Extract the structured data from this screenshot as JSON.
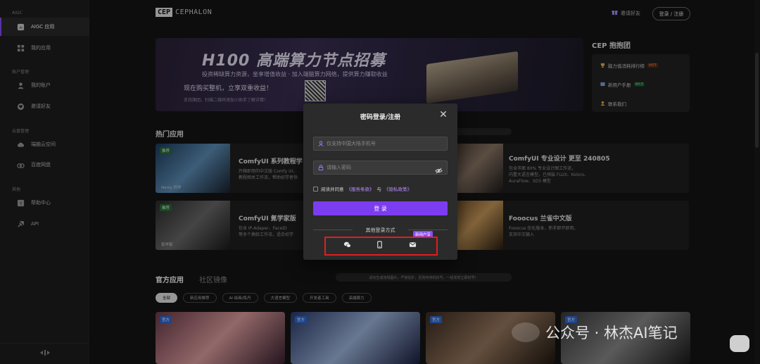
{
  "sidebar": {
    "sections": [
      {
        "label": "AIGC"
      },
      {
        "label": "账户管理"
      },
      {
        "label": "云盘管理"
      },
      {
        "label": "其他"
      }
    ],
    "items": [
      {
        "label": "AIGC 应用",
        "icon": "ai-icon"
      },
      {
        "label": "我的应用",
        "icon": "grid-icon"
      },
      {
        "label": "我的账户",
        "icon": "user-icon"
      },
      {
        "label": "邀请好友",
        "icon": "heart-icon"
      },
      {
        "label": "端脑云空间",
        "icon": "cloud-icon"
      },
      {
        "label": "百度网盘",
        "icon": "baidu-icon"
      },
      {
        "label": "帮助中心",
        "icon": "help-icon"
      },
      {
        "label": "API",
        "icon": "api-icon"
      }
    ]
  },
  "header": {
    "logo_box": "CEP",
    "logo_text": "CEPHALON",
    "invite_label": "邀请好友",
    "login_label": "登录 / 注册"
  },
  "banner": {
    "title": "H100 高端算力节点招募",
    "line1": "投资稀缺算力资源，坐享增值收益 · 加入端脑算力网络，提供算力赚取收益",
    "line2": "现在购买整机，立享双重收益！",
    "line3": "支持旗团，扫描二维码添加小助手了解详情!"
  },
  "cep_panel": {
    "title": "CEP 抱抱团",
    "items": [
      {
        "label": "脑力值消耗排行榜",
        "badge": "HOT"
      },
      {
        "label": "新用户手册",
        "badge": "NICE"
      },
      {
        "label": "联系我们",
        "badge": ""
      }
    ]
  },
  "hot_apps": {
    "title": "热门应用",
    "cards": [
      {
        "tag": "推荐",
        "title": "ComfyUI 系列教程学",
        "desc1": "开箱即用的中文版 Comfy UI，",
        "desc2": "教程相关工作流，帮助初学者快",
        "caption": "Nenly 同学"
      },
      {
        "tag": "",
        "title": "ComfyUI 专业设计 更至 240805",
        "desc1": "包含市面 80% 专业设计图工作流，",
        "desc2": "内置大语言模型，已预装 FLUX、Kolors、",
        "desc3": "AuraFlow、SD3 模型",
        "caption": ""
      },
      {
        "tag": "推荐",
        "title": "ComfyUI 氪学家版",
        "desc1": "包含 IP-Adaper、FaceID",
        "desc2": "等多个换脸工作流，适合初学",
        "caption": "氪学家"
      },
      {
        "tag": "",
        "title": "Fooocus 兰雀中文版",
        "desc1": "Fooocus 优化版本，新手即开即用，",
        "desc2": "支持中文输入",
        "caption": ""
      }
    ]
  },
  "official": {
    "tabs": [
      "官方应用",
      "社区镜像"
    ],
    "notice": "请勿生成违规图片，严禁挖矿，否则将停机封号，一经发现立即封号！",
    "chips": [
      "全部",
      "新应用推荐",
      "AI 绘画/炼丹",
      "大语言模型",
      "开发者工具",
      "高端算力"
    ],
    "card_tag": "官方"
  },
  "modal": {
    "title": "密码登录/注册",
    "phone_placeholder": "仅支持中国大陆手机号",
    "password_placeholder": "请输入密码",
    "agree_prefix": "阅读并同意",
    "terms": "《服务条款》",
    "and": "与",
    "privacy": "《隐私政策》",
    "submit_label": "登 录",
    "other_methods_label": "其他登录方式",
    "new_user_tag": "新用户享",
    "methods": [
      "wechat-icon",
      "phone-icon",
      "email-icon"
    ]
  },
  "watermark": {
    "text": "公众号 · 林杰AI笔记"
  },
  "colors": {
    "accent": "#7c3cf0",
    "highlight_box": "#e01e1e"
  }
}
